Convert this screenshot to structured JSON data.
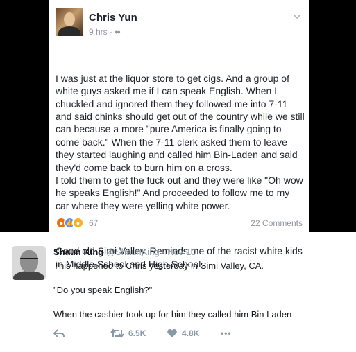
{
  "facebook_post": {
    "author": "Chris Yun",
    "timestamp": "9 hrs ·",
    "paragraphs": [
      "I was just at the liquor store to get cigs. And a group of white guys asked me if I can speak English. When I chuckled and ignored them they followed me into 7-11 and said chinks should get out of the country while we still can because a more \"pure America is finally going to come back.\" When the 7-11 clerk asked them to leave they started laughing and called him Bin-Laden and said they'd come back to burn him on a cross.\nI told them to get the fuck out and they were like \"Oh wow he speaks English!\" And proceeded to follow me to my car where they were yelling white power.",
      "Good old Simi Valley. Reminds me of the racist white kids in Middle School and High School."
    ],
    "reactions": [
      "angry-reaction-icon",
      "like-reaction-icon",
      "sad-reaction-icon"
    ],
    "reaction_count": "67",
    "comments": "22 Comments"
  },
  "tweet": {
    "name": "Shaun King",
    "handle": "@ShaunKing",
    "separator": "·",
    "date": "Nov 10",
    "lines": [
      "This happened to Chris yesterday in Simi Valley, CA.",
      "\"Do you speak English?\"",
      "When the cashier took up for him they called him Bin Laden"
    ],
    "retweets": "6.5K",
    "likes": "4.8K",
    "more": "•••"
  }
}
